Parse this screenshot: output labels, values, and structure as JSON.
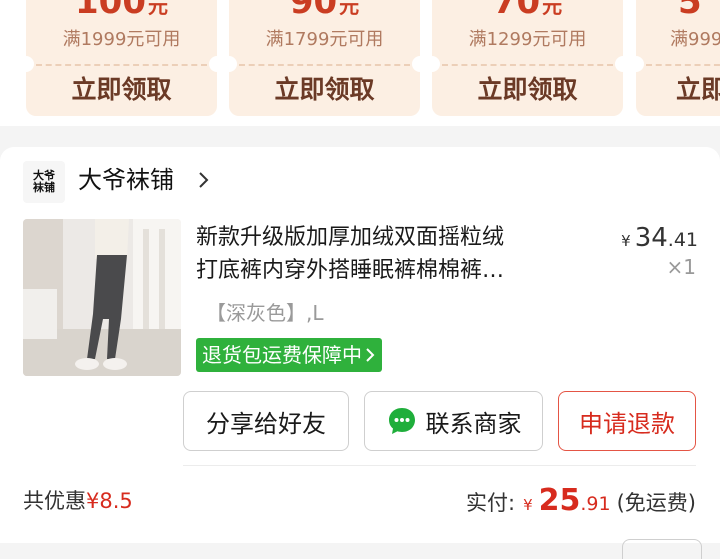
{
  "coupons": [
    {
      "amount": "100",
      "unit": "元",
      "condition": "满1999元可用",
      "claim": "立即领取"
    },
    {
      "amount": "90",
      "unit": "元",
      "condition": "满1799元可用",
      "claim": "立即领取"
    },
    {
      "amount": "70",
      "unit": "元",
      "condition": "满1299元可用",
      "claim": "立即领取"
    },
    {
      "amount": "5",
      "unit": "",
      "condition": "满999",
      "claim": "立即"
    }
  ],
  "shop": {
    "logo_text_line1": "大爷",
    "logo_text_line2": "袜铺",
    "name": "大爷袜铺"
  },
  "product": {
    "title_line1": "新款升级版加厚加绒双面摇粒绒",
    "title_line2": "打底裤内穿外搭睡眠裤棉棉裤…",
    "price_currency": "¥",
    "price_int": "34",
    "price_dec": ".41",
    "quantity": "×1",
    "sku": "【深灰色】,L",
    "guarantee": "退货包运费保障中"
  },
  "actions": {
    "share": "分享给好友",
    "contact": "联系商家",
    "refund": "申请退款"
  },
  "summary": {
    "discount_label": "共优惠",
    "discount_amount": "¥8.5",
    "paid_label": "实付:",
    "paid_currency": "¥",
    "paid_int": "25",
    "paid_dec": ".91",
    "shipping_note": "(免运费)"
  },
  "colors": {
    "accent_red": "#d72b1e",
    "coupon_bg": "#fcefe3",
    "guarantee_green": "#2fb13c"
  }
}
